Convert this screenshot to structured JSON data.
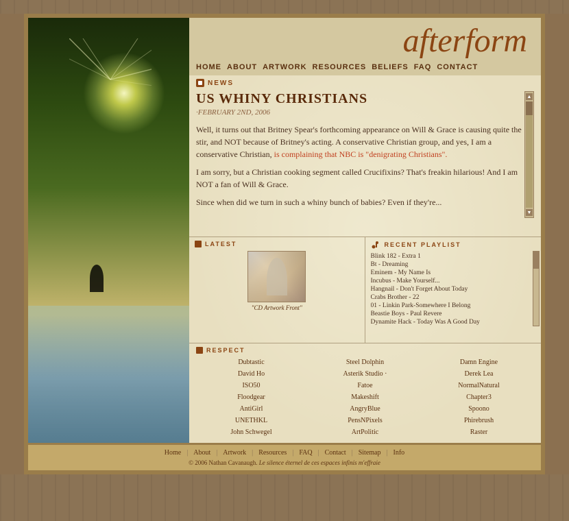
{
  "site": {
    "logo": "afterform",
    "tagline": ""
  },
  "nav": {
    "items": [
      {
        "label": "HOME",
        "id": "home"
      },
      {
        "label": "ABOUT",
        "id": "about"
      },
      {
        "label": "ARTWORK",
        "id": "artwork"
      },
      {
        "label": "RESOURCES",
        "id": "resources"
      },
      {
        "label": "BELIEFS",
        "id": "beliefs"
      },
      {
        "label": "FAQ",
        "id": "faq"
      },
      {
        "label": "CONTACT",
        "id": "contact"
      }
    ]
  },
  "news": {
    "section_label": "NEWS",
    "article": {
      "title": "US WHINY CHRISTIANS",
      "date": "·FEBRUARY 2ND, 2006",
      "paragraphs": [
        "Well, it turns out that Britney Spear's forthcoming appearance on Will & Grace is causing quite the stir, and NOT because of Britney's acting. A conservative Christian group, and yes, I am a conservative Christian, is complaining that NBC is \"denigrating Christians\".",
        "I am sorry, but a Christian cooking segment called Crucifixins? That's freakin hilarious! And I am NOT a fan of Will & Grace.",
        "Since when did we turn in such a whiny bunch of babies? Even if they're..."
      ],
      "link_text": "is complaining that NBC is \"denigrating Christians\"."
    }
  },
  "latest": {
    "section_label": "LATEST",
    "artwork": {
      "caption": "\"CD Artwork Front\""
    }
  },
  "playlist": {
    "section_label": "RECENT PLAYLIST",
    "items": [
      "Blink 182 - Extra 1",
      "Bt - Dreaming",
      "Eminem - My Name Is",
      "Incubus - Make Yourself...",
      "Hangnail - Don't Forget About Today",
      "Crabs Brother - 22",
      "01 - Linkin Park-Somewhere I Belong",
      "Beastie Boys - Paul Revere",
      "Dynamite Hack - Today Was A Good Day"
    ]
  },
  "respect": {
    "section_label": "RESPECT",
    "items": [
      "Dubtastic",
      "Steel Dolphin",
      "Damn Engine",
      "David Ho",
      "Asterik Studio ·",
      "Derek Lea",
      "ISO50",
      "Fatoe",
      "NormalNatural",
      "Floodgear",
      "Makeshift",
      "Chapter3",
      "AntiGirl",
      "AngryBlue",
      "Spoono",
      "UNETHKL",
      "PensNPixels",
      "Phirebrush",
      "John Schwegel",
      "ArtPolitic",
      "Raster"
    ]
  },
  "footer": {
    "links": [
      "Home",
      "About",
      "Artwork",
      "Resources",
      "FAQ",
      "Contact",
      "Sitemap",
      "Info"
    ],
    "copyright": "© 2006 Nathan Cavanaugh.",
    "quote": "Le silence éternel de ces espaces infinis m'effraie"
  }
}
